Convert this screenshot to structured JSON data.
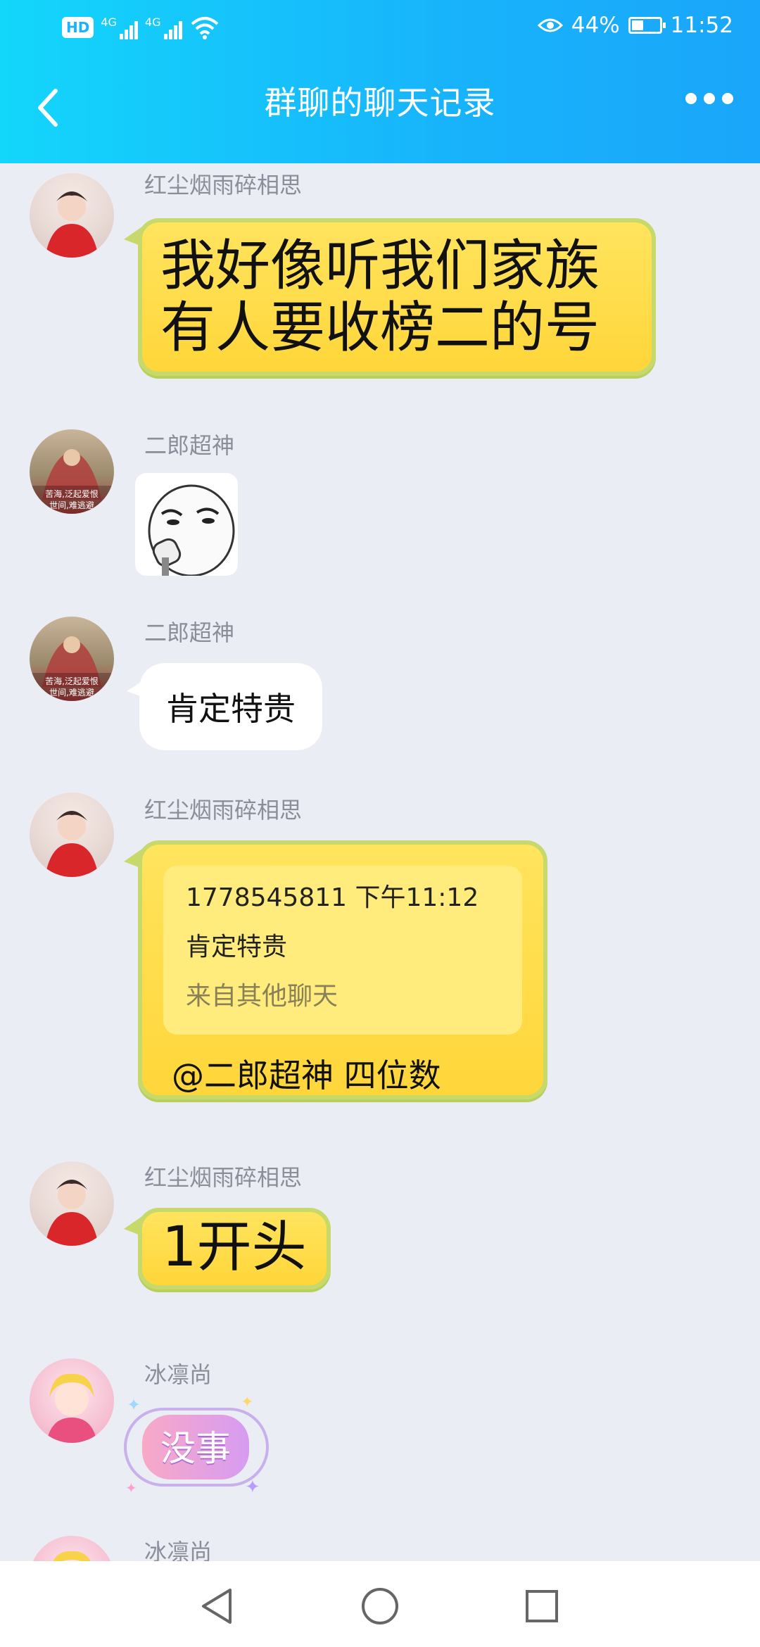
{
  "status_bar": {
    "network_badge": "HD",
    "signal1_label": "4G",
    "signal2_label": "4G",
    "battery": "44%",
    "battery_level": 0.44,
    "time": "11:52",
    "icons": [
      "eye-icon",
      "wifi-icon",
      "battery-icon"
    ]
  },
  "header": {
    "title": "群聊的聊天记录",
    "back_icon": "chevron-left-icon",
    "more_icon": "more-dots-icon"
  },
  "messages": [
    {
      "sender": "红尘烟雨碎相思",
      "lines": [
        "我好像听我们家族",
        "有人要收榜二的号"
      ],
      "type": "text-yellow"
    },
    {
      "sender": "二郎超神",
      "type": "sticker",
      "avatar_caption": [
        "苦海,泛起爱恨",
        "世间,难逃避"
      ]
    },
    {
      "sender": "二郎超神",
      "text": "肯定特贵",
      "type": "text-white",
      "avatar_caption": [
        "苦海,泛起爱恨",
        "世间,难逃避"
      ]
    },
    {
      "sender": "红尘烟雨碎相思",
      "type": "quote",
      "quote": {
        "header": "1778545811 下午11:12",
        "body": "肯定特贵",
        "source": "来自其他聊天"
      },
      "text": "@二郎超神 四位数"
    },
    {
      "sender": "红尘烟雨碎相思",
      "text": "1开头",
      "type": "text-yellow"
    },
    {
      "sender": "冰凛尚",
      "type": "sticker-text",
      "sticker_text": "没事"
    },
    {
      "sender": "冰凛尚",
      "type": "partial"
    }
  ],
  "nav": {
    "back_icon": "triangle-back-icon",
    "home_icon": "circle-home-icon",
    "recents_icon": "square-recents-icon"
  }
}
